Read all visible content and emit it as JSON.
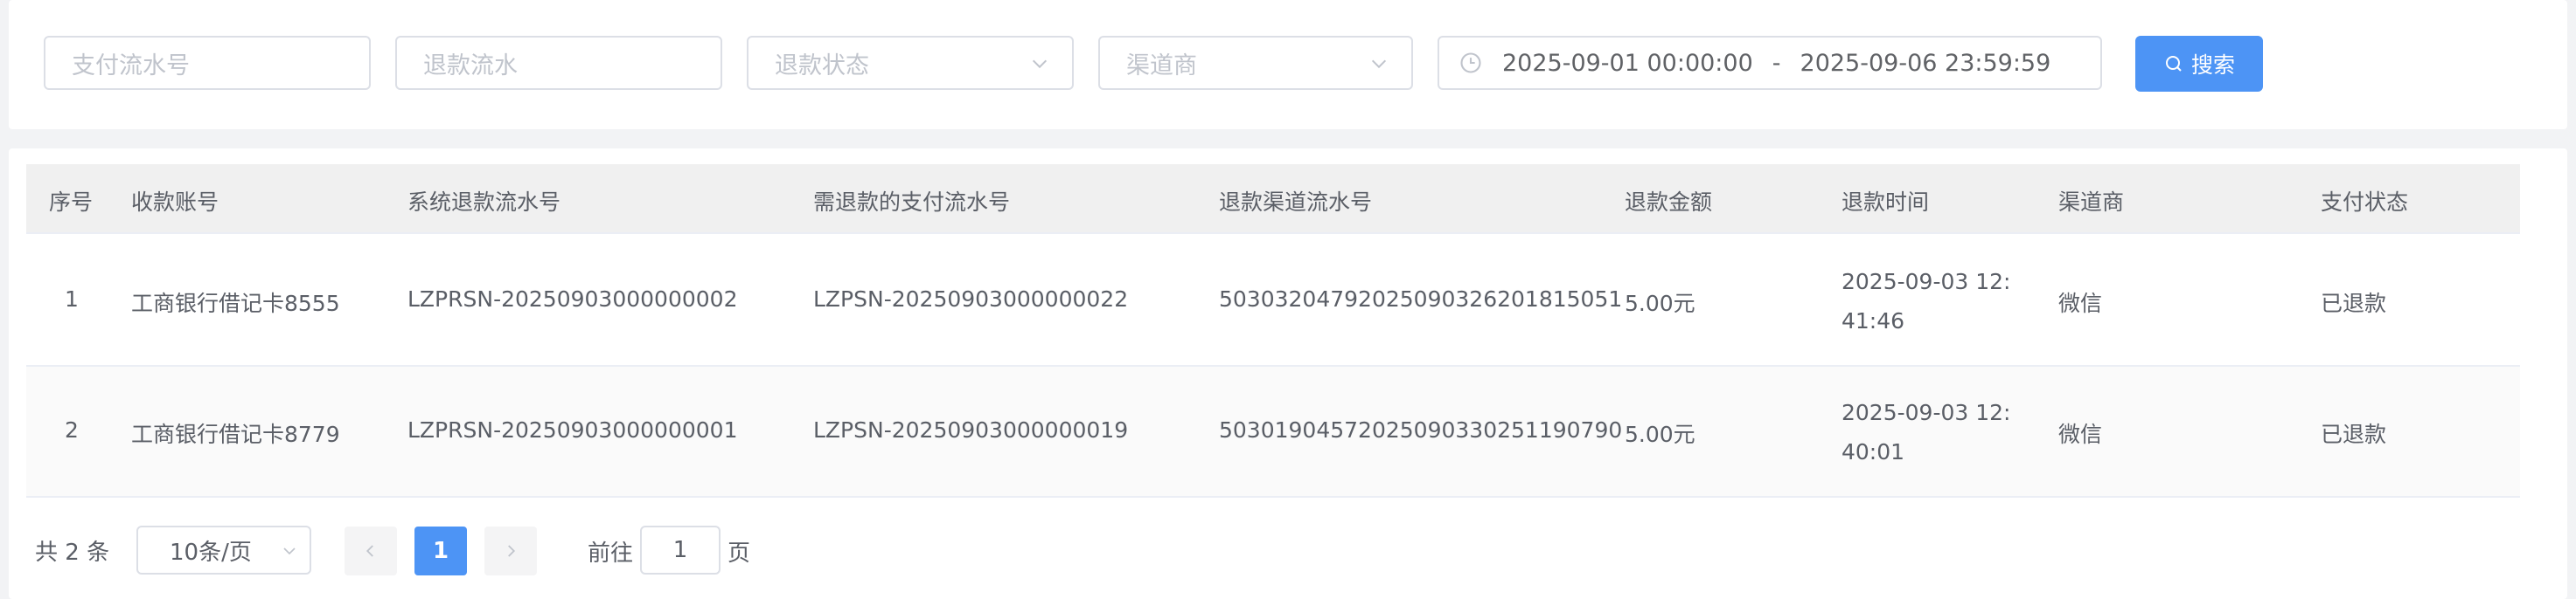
{
  "filters": {
    "payment_serial_placeholder": "支付流水号",
    "refund_serial_placeholder": "退款流水",
    "refund_status_placeholder": "退款状态",
    "channel_placeholder": "渠道商",
    "date_start": "2025-09-01 00:00:00",
    "date_separator": "-",
    "date_end": "2025-09-06 23:59:59",
    "search_label": "搜索"
  },
  "table": {
    "headers": {
      "index": "序号",
      "account": "收款账号",
      "system_refund_serial": "系统退款流水号",
      "payment_serial": "需退款的支付流水号",
      "channel_refund_serial": "退款渠道流水号",
      "amount": "退款金额",
      "refund_time": "退款时间",
      "channel": "渠道商",
      "pay_status": "支付状态"
    },
    "rows": [
      {
        "index": "1",
        "account": "工商银行借记卡8555",
        "system_refund_serial": "LZPRSN-20250903000000002",
        "payment_serial": "LZPSN-20250903000000022",
        "channel_refund_serial": "503032047920250903262018150​51",
        "amount": "5.00元",
        "refund_time": "2025-09-03 12:41:46",
        "channel": "微信",
        "pay_status": "已退款"
      },
      {
        "index": "2",
        "account": "工商银行借记卡8779",
        "system_refund_serial": "LZPRSN-20250903000000001",
        "payment_serial": "LZPSN-20250903000000019",
        "channel_refund_serial": "50301904572025090330251190790",
        "amount": "5.00元",
        "refund_time": "2025-09-03 12:40:01",
        "channel": "微信",
        "pay_status": "已退款"
      }
    ]
  },
  "pagination": {
    "total_text": "共 2 条",
    "page_size": "10条/页",
    "current_page": "1",
    "goto_prefix": "前往",
    "goto_value": "1",
    "goto_suffix": "页"
  },
  "colors": {
    "accent": "#4d94f5",
    "page_bg": "#f2f3f5",
    "header_bg": "#f0f0f0"
  }
}
